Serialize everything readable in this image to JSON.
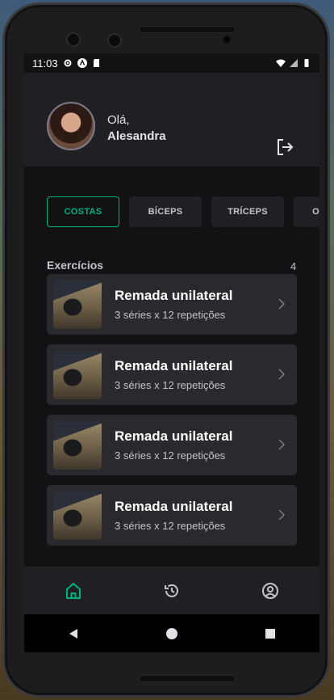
{
  "status_bar": {
    "time": "11:03"
  },
  "header": {
    "greeting": "Olá,",
    "user_name": "Alesandra"
  },
  "tabs": [
    {
      "label": "COSTAS",
      "active": true
    },
    {
      "label": "BÍCEPS",
      "active": false
    },
    {
      "label": "TRÍCEPS",
      "active": false
    },
    {
      "label": "OMBRO",
      "active": false
    }
  ],
  "exercises": {
    "title": "Exercícios",
    "count": "4",
    "items": [
      {
        "name": "Remada unilateral",
        "detail": "3 séries x 12 repetições"
      },
      {
        "name": "Remada unilateral",
        "detail": "3 séries x 12 repetições"
      },
      {
        "name": "Remada unilateral",
        "detail": "3 séries x 12 repetições"
      },
      {
        "name": "Remada unilateral",
        "detail": "3 séries x 12 repetições"
      }
    ]
  },
  "bottom_nav": {
    "items": [
      "home-icon",
      "history-icon",
      "profile-icon"
    ],
    "active": "home-icon"
  },
  "colors": {
    "accent": "#00b37e",
    "background": "#121214",
    "surface": "#202024",
    "card": "#29292e"
  }
}
